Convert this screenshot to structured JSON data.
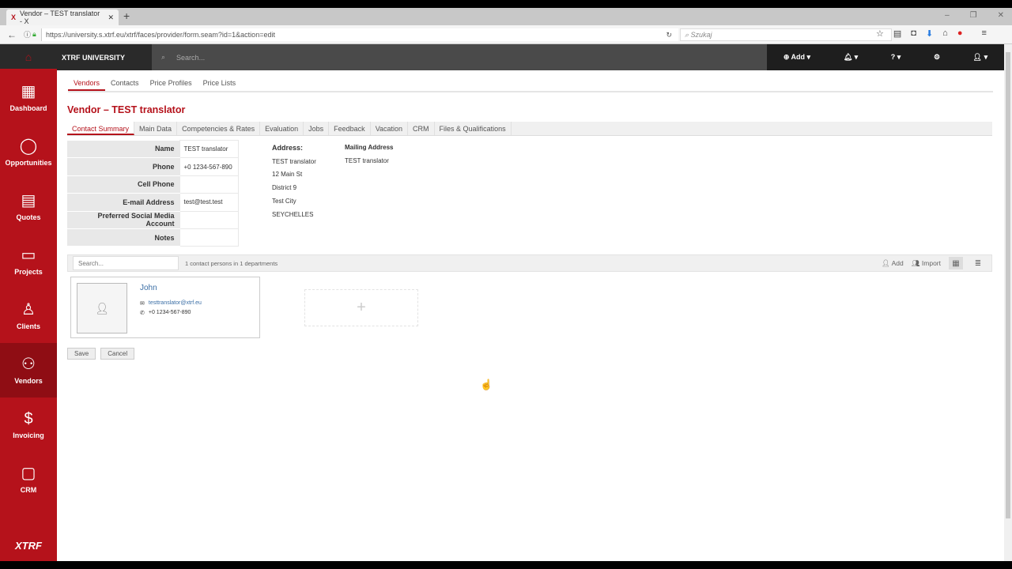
{
  "browser": {
    "tab_title": "Vendor – TEST translator - X",
    "url": "https://university.s.xtrf.eu/xtrf/faces/provider/form.seam?id=1&action=edit",
    "search_placeholder": "Szukaj"
  },
  "topbar": {
    "brand": "XTRF UNIVERSITY",
    "search_placeholder": "Search...",
    "add_label": "Add"
  },
  "sidebar": {
    "items": [
      {
        "label": "Dashboard",
        "icon": "▦"
      },
      {
        "label": "Opportunities",
        "icon": "◯"
      },
      {
        "label": "Quotes",
        "icon": "▤"
      },
      {
        "label": "Projects",
        "icon": "▭"
      },
      {
        "label": "Clients",
        "icon": "♙"
      },
      {
        "label": "Vendors",
        "icon": "⚇"
      },
      {
        "label": "Invoicing",
        "icon": "$"
      },
      {
        "label": "CRM",
        "icon": "▢"
      }
    ],
    "logo": "XTRF",
    "active": "Vendors"
  },
  "subnav": [
    "Vendors",
    "Contacts",
    "Price Profiles",
    "Price Lists"
  ],
  "page_title": "Vendor – TEST translator",
  "tabs": [
    "Contact Summary",
    "Main Data",
    "Competencies & Rates",
    "Evaluation",
    "Jobs",
    "Feedback",
    "Vacation",
    "CRM",
    "Files & Qualifications"
  ],
  "info": [
    {
      "label": "Name",
      "value": "TEST translator"
    },
    {
      "label": "Phone",
      "value": "+0 1234-567-890"
    },
    {
      "label": "Cell Phone",
      "value": ""
    },
    {
      "label": "E-mail Address",
      "value": "test@test.test"
    },
    {
      "label": "Preferred Social Media Account",
      "value": ""
    },
    {
      "label": "Notes",
      "value": ""
    }
  ],
  "address": {
    "heading": "Address:",
    "lines": [
      "TEST translator",
      "12 Main St",
      "District 9",
      "Test City",
      "SEYCHELLES"
    ]
  },
  "mailing": {
    "heading": "Mailing Address",
    "lines": [
      "TEST translator"
    ]
  },
  "contacts": {
    "search_placeholder": "Search...",
    "count": "1 contact persons in 1 departments",
    "add": "Add",
    "import": "Import",
    "person": {
      "name": "John",
      "email": "testtranslator@xtrf.eu",
      "phone": "+0 1234-567-890"
    }
  },
  "actions": {
    "save": "Save",
    "cancel": "Cancel"
  },
  "colors": {
    "brand": "#b5121b"
  }
}
